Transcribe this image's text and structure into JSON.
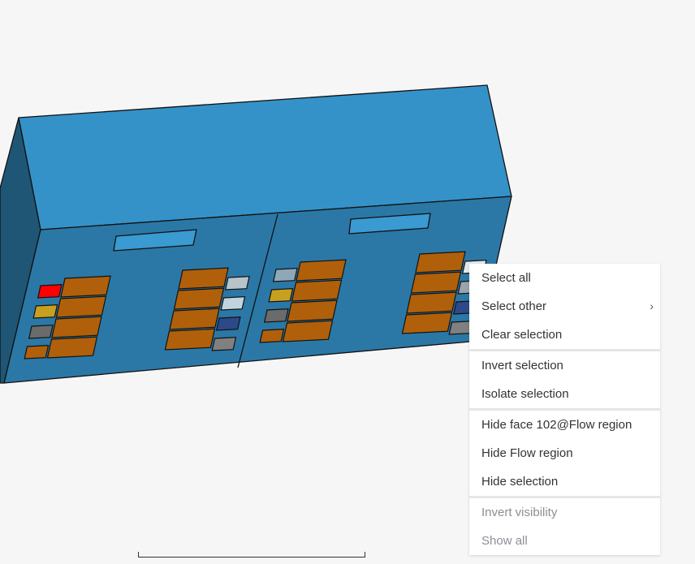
{
  "context_menu": {
    "groups": [
      {
        "items": [
          {
            "label": "Select all",
            "enabled": true
          },
          {
            "label": "Select other",
            "enabled": true,
            "submenu": true,
            "submenu_icon": "chevron-right-icon",
            "submenu_glyph": "›"
          },
          {
            "label": "Clear selection",
            "enabled": true
          }
        ]
      },
      {
        "items": [
          {
            "label": "Invert selection",
            "enabled": true
          },
          {
            "label": "Isolate selection",
            "enabled": true
          }
        ]
      },
      {
        "items": [
          {
            "label": "Hide face 102@Flow region",
            "enabled": true
          },
          {
            "label": "Hide Flow region",
            "enabled": true
          },
          {
            "label": "Hide selection",
            "enabled": true
          }
        ]
      },
      {
        "items": [
          {
            "label": "Invert visibility",
            "enabled": false
          },
          {
            "label": "Show all",
            "enabled": false
          }
        ]
      }
    ]
  },
  "colors": {
    "background": "#f6f6f6",
    "model_top": "#3592c8",
    "model_front": "#2b78a6",
    "model_side": "#1f5675",
    "panel": "#b0600a",
    "highlight_red": "#ff0000"
  }
}
